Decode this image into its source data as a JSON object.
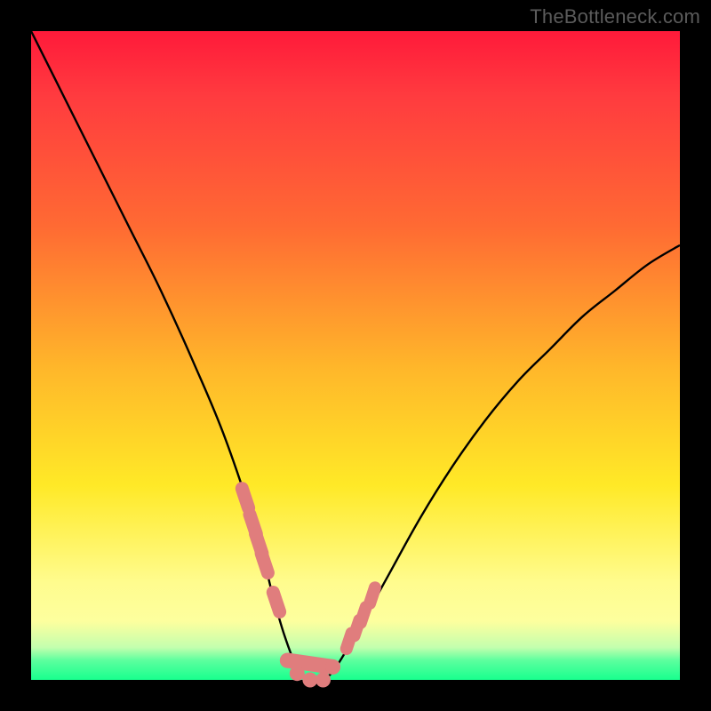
{
  "watermark": "TheBottleneck.com",
  "colors": {
    "background": "#000000",
    "gradient_top": "#ff1a3a",
    "gradient_mid": "#ffe927",
    "gradient_bottom": "#18ff8e",
    "curve": "#000000",
    "markers": "#e07d7d"
  },
  "chart_data": {
    "type": "line",
    "title": "",
    "xlabel": "",
    "ylabel": "",
    "xlim": [
      0,
      100
    ],
    "ylim": [
      0,
      100
    ],
    "grid": false,
    "legend": false,
    "series": [
      {
        "name": "bottleneck-curve",
        "x": [
          0,
          5,
          10,
          15,
          20,
          25,
          30,
          35,
          37,
          39,
          41,
          43,
          45,
          47,
          50,
          55,
          60,
          65,
          70,
          75,
          80,
          85,
          90,
          95,
          100
        ],
        "y": [
          100,
          90,
          80,
          70,
          60,
          49,
          37,
          22,
          14,
          7,
          2,
          0,
          0,
          2,
          7,
          16,
          25,
          33,
          40,
          46,
          51,
          56,
          60,
          64,
          67
        ]
      }
    ],
    "markers": {
      "left_cluster_x": [
        33.0,
        34.2,
        35.1,
        36.0,
        37.8
      ],
      "left_cluster_y": [
        28,
        24,
        21,
        18,
        12
      ],
      "bottom_cluster_x": [
        39.5,
        41.0,
        43.0,
        45.0,
        46.5
      ],
      "bottom_cluster_y": [
        3,
        1,
        0,
        0,
        2
      ],
      "right_cluster_x": [
        49.0,
        50.2,
        51.2,
        52.6
      ],
      "right_cluster_y": [
        6,
        8,
        10,
        13
      ]
    }
  }
}
